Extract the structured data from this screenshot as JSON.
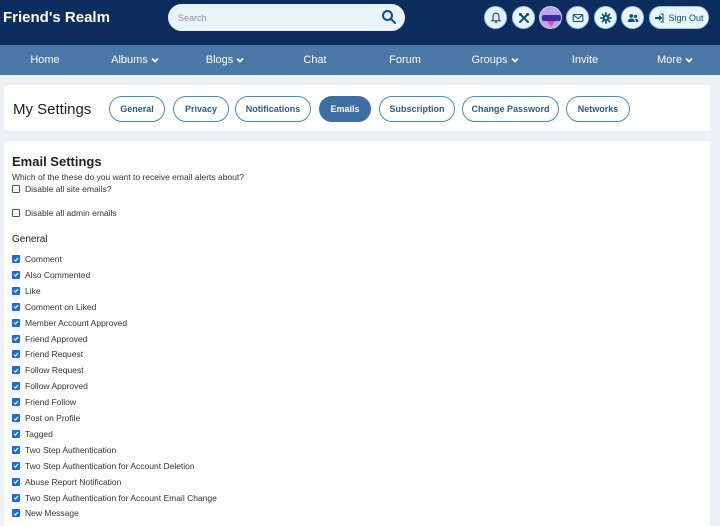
{
  "header": {
    "brand": "Friend's Realm",
    "search_placeholder": "Search",
    "sign_out_label": "Sign Out",
    "icons": [
      "bell-icon",
      "tools-icon",
      "avatar",
      "envelope-icon",
      "gear-icon",
      "users-icon"
    ]
  },
  "nav": [
    {
      "label": "Home",
      "dropdown": false
    },
    {
      "label": "Albums",
      "dropdown": true
    },
    {
      "label": "Blogs",
      "dropdown": true
    },
    {
      "label": "Chat",
      "dropdown": false
    },
    {
      "label": "Forum",
      "dropdown": false
    },
    {
      "label": "Groups",
      "dropdown": true
    },
    {
      "label": "Invite",
      "dropdown": false
    },
    {
      "label": "More",
      "dropdown": true
    }
  ],
  "settings": {
    "title": "My Settings",
    "tabs": [
      "General",
      "Privacy",
      "Notifications",
      "Emails",
      "Subscription",
      "Change Password",
      "Networks"
    ],
    "active_tab": "Emails"
  },
  "email": {
    "title": "Email Settings",
    "question": "Which of the these do you want to receive email alerts about?",
    "disable_site": "Disable all site emails?",
    "disable_admin": "Disable all admin emails",
    "general_heading": "General",
    "items": [
      {
        "label": "Comment",
        "checked": true
      },
      {
        "label": "Also Commented",
        "checked": true
      },
      {
        "label": "Like",
        "checked": true
      },
      {
        "label": "Comment on Liked",
        "checked": true
      },
      {
        "label": "Member Account Approved",
        "checked": true
      },
      {
        "label": "Friend Approved",
        "checked": true
      },
      {
        "label": "Friend Request",
        "checked": true
      },
      {
        "label": "Follow Request",
        "checked": true
      },
      {
        "label": "Follow Approved",
        "checked": true
      },
      {
        "label": "Friend Follow",
        "checked": true
      },
      {
        "label": "Post on Profile",
        "checked": true
      },
      {
        "label": "Tagged",
        "checked": true
      },
      {
        "label": "Two Step Authentication",
        "checked": true
      },
      {
        "label": "Two Step Authentication for Account Deletion",
        "checked": true
      },
      {
        "label": "Abuse Report Notification",
        "checked": true
      },
      {
        "label": "Two Step Authentication for Account Email Change",
        "checked": true
      },
      {
        "label": "New Message",
        "checked": true
      }
    ]
  },
  "colors": {
    "topbar": "#0c2d5e",
    "navbar": "#4a76a8",
    "accent": "#3b8fd0",
    "active_tab": "#3d6fa5",
    "checkbox": "#1a6ed8"
  }
}
